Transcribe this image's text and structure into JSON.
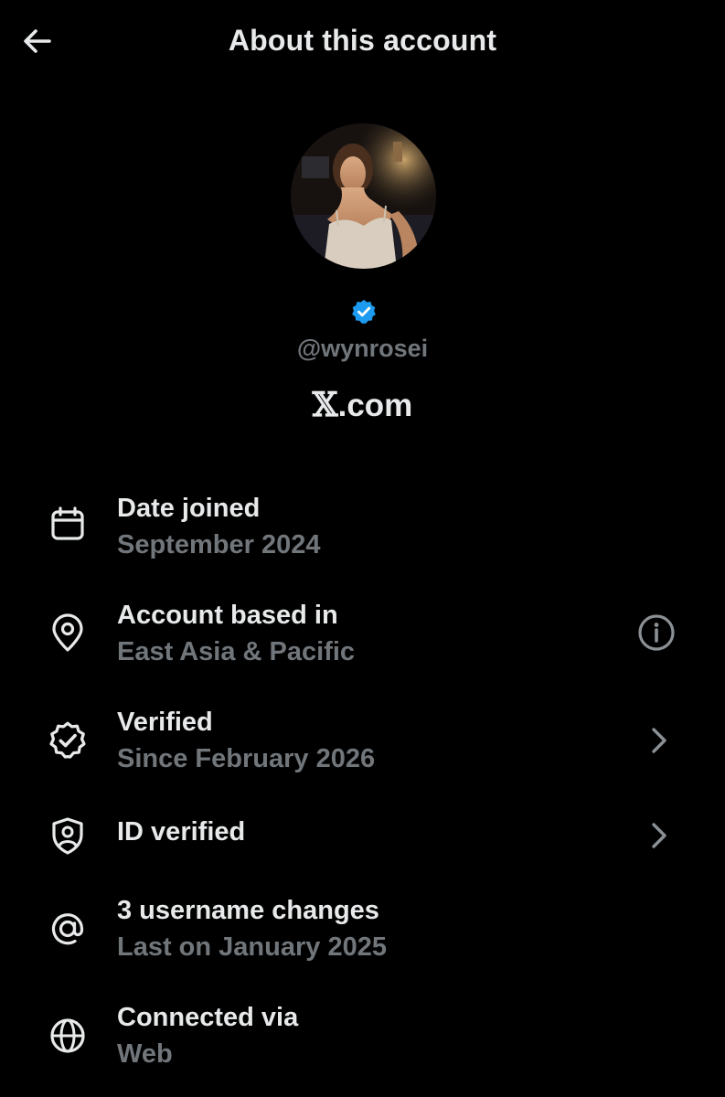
{
  "header": {
    "back_icon": "arrow-left-icon",
    "title": "About this account"
  },
  "profile": {
    "avatar": "profile-photo",
    "badge_color": "#1d9bf0",
    "handle": "@wynrosei",
    "source_logo": "𝕏",
    "source_suffix": ".com"
  },
  "rows": [
    {
      "icon": "calendar-icon",
      "title": "Date joined",
      "subtitle": "September 2024"
    },
    {
      "icon": "location-pin-icon",
      "title": "Account based in",
      "subtitle": "East Asia & Pacific",
      "action_icon": "info-icon"
    },
    {
      "icon": "verified-badge-outline-icon",
      "title": "Verified",
      "subtitle": "Since February 2026",
      "action_icon": "chevron-right-icon"
    },
    {
      "icon": "shield-person-icon",
      "title": "ID verified",
      "action_icon": "chevron-right-icon"
    },
    {
      "icon": "at-sign-icon",
      "title": "3 username changes",
      "subtitle": "Last on January 2025"
    },
    {
      "icon": "globe-icon",
      "title": "Connected via",
      "subtitle": "Web"
    }
  ],
  "colors": {
    "background": "#000000",
    "primary_text": "#e7e9ea",
    "secondary_text": "#71767b",
    "accent": "#1d9bf0"
  }
}
